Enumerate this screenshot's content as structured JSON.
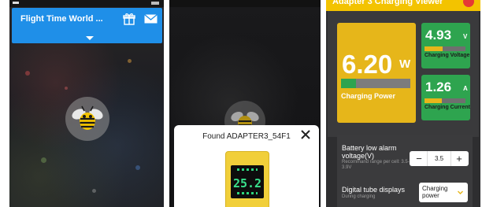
{
  "screen1": {
    "banner_title": "Flight Time World ...",
    "icons": [
      "gift-icon",
      "mail-icon",
      "caret-down-icon",
      "bee-logo-icon"
    ],
    "colors": {
      "banner": "#1f8fe8",
      "brand_yellow": "#f3c300"
    }
  },
  "screen2": {
    "dialog_title": "Found ADAPTER3_54F1",
    "device_display_value": "25.2",
    "icons": [
      "close-icon",
      "bee-logo-icon",
      "adapter-device-image"
    ]
  },
  "screen3": {
    "header_title": "Adapter 3 Charging Viewer",
    "power": {
      "value": "6.20",
      "unit": "W",
      "label": "Charging Power",
      "level_fraction": 0.22
    },
    "voltage": {
      "value": "4.93",
      "unit": "V",
      "label": "Charging Voltage",
      "level_fraction": 0.45
    },
    "current": {
      "value": "1.26",
      "unit": "A",
      "label": "Charging Current",
      "level_fraction": 0.42
    },
    "battery_alarm": {
      "title": "Battery low alarm voltage(V)",
      "subtitle": "Recommand range per cell: 3.5-3.9V",
      "value": "3.5",
      "minus_label": "−",
      "plus_label": "+"
    },
    "tube_display": {
      "title": "Digital tube displays",
      "subtitle": "During charging",
      "selected": "Charging power"
    },
    "colors": {
      "header": "#f3c300",
      "card_yellow": "#e6b61a",
      "card_green": "#2ea44f",
      "alert": "#e53935"
    }
  }
}
